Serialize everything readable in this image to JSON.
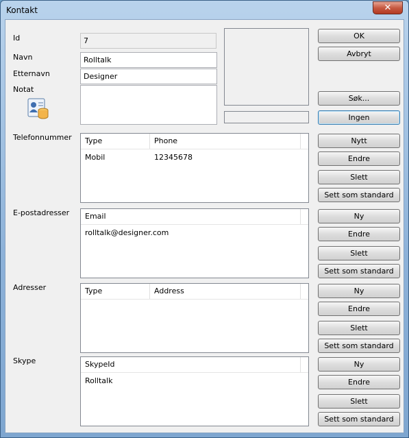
{
  "window": {
    "title": "Kontakt",
    "close_glyph": "✕"
  },
  "form": {
    "id_label": "Id",
    "id_value": "7",
    "navn_label": "Navn",
    "navn_value": "Rolltalk",
    "etternavn_label": "Etternavn",
    "etternavn_value": "Designer",
    "notat_label": "Notat",
    "notat_value": ""
  },
  "buttons": {
    "ok": "OK",
    "avbryt": "Avbryt",
    "sok": "Søk...",
    "ingen": "Ingen",
    "phone_new": "Nytt",
    "phone_edit": "Endre",
    "phone_delete": "Slett",
    "phone_default": "Sett som standard",
    "email_new": "Ny",
    "email_edit": "Endre",
    "email_delete": "Slett",
    "email_default": "Sett som standard",
    "addr_new": "Ny",
    "addr_edit": "Endre",
    "addr_delete": "Slett",
    "addr_default": "Sett som standard",
    "skype_new": "Ny",
    "skype_edit": "Endre",
    "skype_delete": "Slett",
    "skype_default": "Sett som standard"
  },
  "phone": {
    "label": "Telefonnummer",
    "col_type": "Type",
    "col_phone": "Phone",
    "rows": [
      {
        "type": "Mobil",
        "phone": "12345678"
      }
    ]
  },
  "email": {
    "label": "E-postadresser",
    "col_email": "Email",
    "rows": [
      {
        "email": "rolltalk@designer.com"
      }
    ]
  },
  "address": {
    "label": "Adresser",
    "col_type": "Type",
    "col_address": "Address"
  },
  "skype": {
    "label": "Skype",
    "col_id": "SkypeId",
    "rows": [
      {
        "id": "Rolltalk"
      }
    ]
  },
  "icons": {
    "contact_card": "contact-card-database-icon"
  },
  "colors": {
    "title_gradient_top": "#b9d3ec",
    "close_red": "#c75a42",
    "focus_border": "#3c7fb1"
  }
}
